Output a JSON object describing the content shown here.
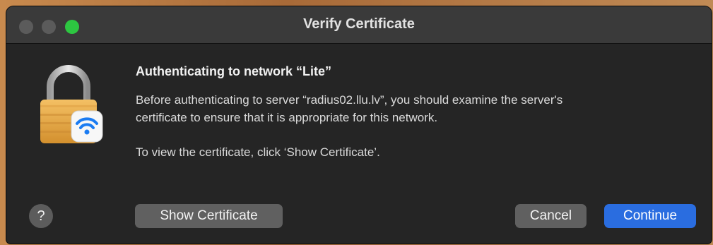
{
  "window": {
    "title": "Verify Certificate"
  },
  "dialog": {
    "heading": "Authenticating to network “Lite”",
    "paragraph_1_line_1": "Before authenticating to server “radius02.llu.lv”, you should examine the server's",
    "paragraph_1_line_2": "certificate to ensure that it is appropriate for this network.",
    "paragraph_2": "To view the certificate, click ‘Show Certificate’.",
    "icon": "lock-wifi-icon"
  },
  "buttons": {
    "help": "?",
    "show_certificate": "Show Certificate",
    "cancel": "Cancel",
    "continue": "Continue"
  },
  "colors": {
    "window_bg": "#252525",
    "titlebar_bg": "#3a3a3a",
    "accent": "#2a6de0",
    "zoom_green": "#2dc641"
  }
}
